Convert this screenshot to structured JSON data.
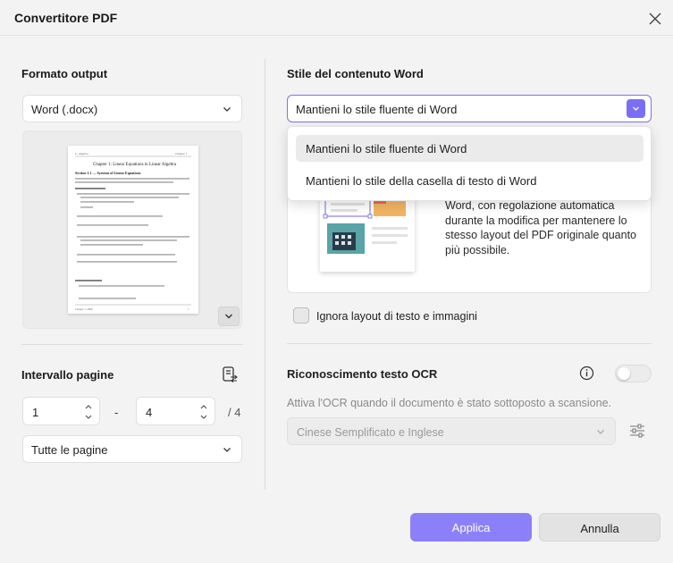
{
  "window": {
    "title": "Convertitore PDF"
  },
  "left": {
    "output_format_label": "Formato output",
    "output_format_value": "Word (.docx)",
    "preview": {
      "running_head_left": "L. Algebra",
      "running_head_right": "Chapter 1",
      "chapter_title": "Chapter 1: Linear Equations in Linear Algebra",
      "section_title": "Section 1.1 — Systems of Linear Equations",
      "footer_left": "Chapter 1: 2008",
      "footer_right": "1"
    },
    "page_range_label": "Intervallo pagine",
    "range_from": "1",
    "range_sep": "-",
    "range_to": "4",
    "range_total": "/ 4",
    "pages_option": "Tutte le pagine"
  },
  "right": {
    "word_style_label": "Stile del contenuto Word",
    "word_style_value": "Mantieni lo stile fluente di Word",
    "options": [
      {
        "label": "Mantieni lo stile fluente di Word",
        "selected": true
      },
      {
        "label": "Mantieni lo stile della casella di testo di Word",
        "selected": false
      }
    ],
    "style_description": "Word, con regolazione automatica durante la modifica per mantenere lo stesso layout del PDF originale quanto più possibile.",
    "ignore_layout_label": "Ignora layout di testo e immagini",
    "ignore_layout_checked": false,
    "ocr_title": "Riconoscimento testo OCR",
    "ocr_enabled": false,
    "ocr_description": "Attiva l'OCR quando il documento è stato sottoposto a scansione.",
    "ocr_language": "Cinese Semplificato e Inglese"
  },
  "buttons": {
    "apply": "Applica",
    "cancel": "Annulla"
  },
  "colors": {
    "accent": "#8c80f8",
    "accent_dark": "#7b6ef6",
    "background": "#f3f3f3"
  }
}
